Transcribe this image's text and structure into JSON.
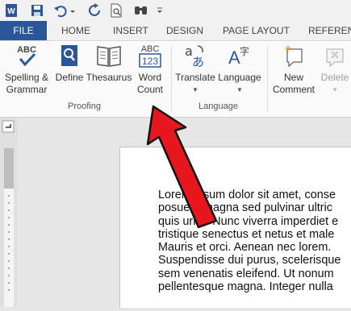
{
  "colors": {
    "accent": "#2b579a",
    "arrow": "#e8171e"
  },
  "qat": {
    "icons": [
      "word-app-icon",
      "save-icon",
      "undo-icon",
      "redo-icon",
      "print-preview-icon",
      "find-icon",
      "customize-qat-icon"
    ]
  },
  "tabs": [
    "FILE",
    "HOME",
    "INSERT",
    "DESIGN",
    "PAGE LAYOUT",
    "REFERENC"
  ],
  "ribbon": {
    "proofing": {
      "spelling": [
        "Spelling &",
        "Grammar"
      ],
      "define": "Define",
      "thesaurus": "Thesaurus",
      "word_count": [
        "Word",
        "Count"
      ],
      "group_label": "Proofing",
      "abc_glyph": "ABC",
      "count_glyph": "123"
    },
    "language": {
      "translate": "Translate",
      "language": "Language",
      "group_label": "Language"
    },
    "comments": {
      "new_comment": [
        "New",
        "Comment"
      ],
      "delete": "Delete"
    }
  },
  "document": {
    "lines": [
      "Lorem ipsum dolor sit amet, conse",
      "posuere magna sed pulvinar ultric",
      "quis urna. Nunc viverra imperdiet e",
      "tristique senectus et netus et male",
      "Mauris et orci. Aenean nec lorem.",
      "Suspendisse dui purus, scelerisque",
      "sem venenatis eleifend. Ut nonum",
      "pellentesque magna. Integer nulla"
    ]
  }
}
